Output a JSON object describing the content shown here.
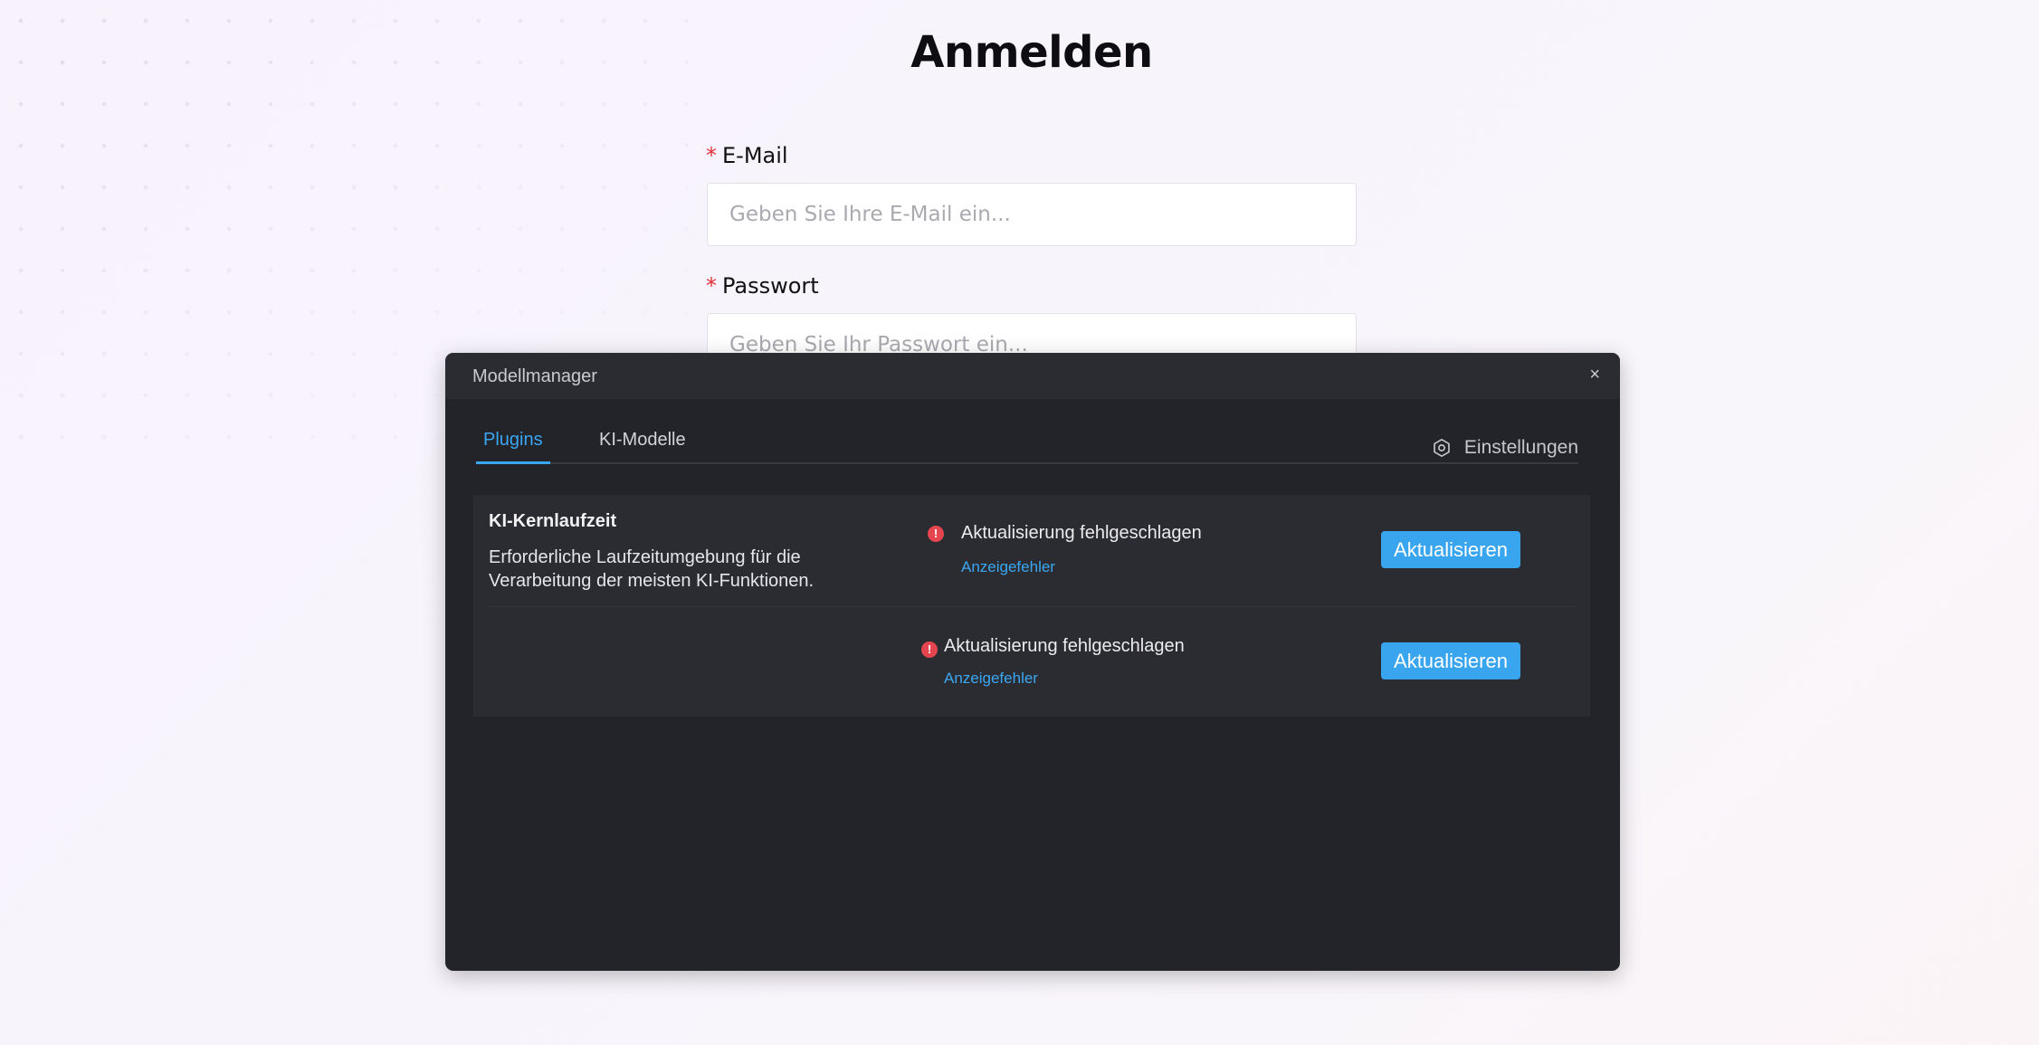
{
  "login": {
    "title": "Anmelden",
    "email": {
      "required_mark": "*",
      "label": "E-Mail",
      "placeholder": "Geben Sie Ihre E-Mail ein..."
    },
    "password": {
      "required_mark": "*",
      "label": "Passwort",
      "placeholder": "Geben Sie Ihr Passwort ein..."
    }
  },
  "modal": {
    "title": "Modellmanager",
    "close_glyph": "×",
    "tabs": [
      {
        "label": "Plugins",
        "active": true
      },
      {
        "label": "KI-Modelle",
        "active": false
      }
    ],
    "settings_label": "Einstellungen",
    "plugin": {
      "name": "KI-Kernlaufzeit",
      "description": "Erforderliche Laufzeitumgebung für die Verarbeitung der meisten KI-Funktionen.",
      "rows": [
        {
          "status": "Aktualisierung fehlgeschlagen",
          "error_link": "Anzeigefehler",
          "button": "Aktualisieren",
          "status_icon": "error-icon"
        },
        {
          "status": "Aktualisierung fehlgeschlagen",
          "error_link": "Anzeigefehler",
          "button": "Aktualisieren",
          "status_icon": "error-icon"
        }
      ]
    }
  },
  "colors": {
    "accent": "#3ba7f2",
    "error": "#e5454e",
    "required": "#e0303a",
    "modal_bg": "#23242a",
    "panel_bg": "#2b2c31"
  }
}
